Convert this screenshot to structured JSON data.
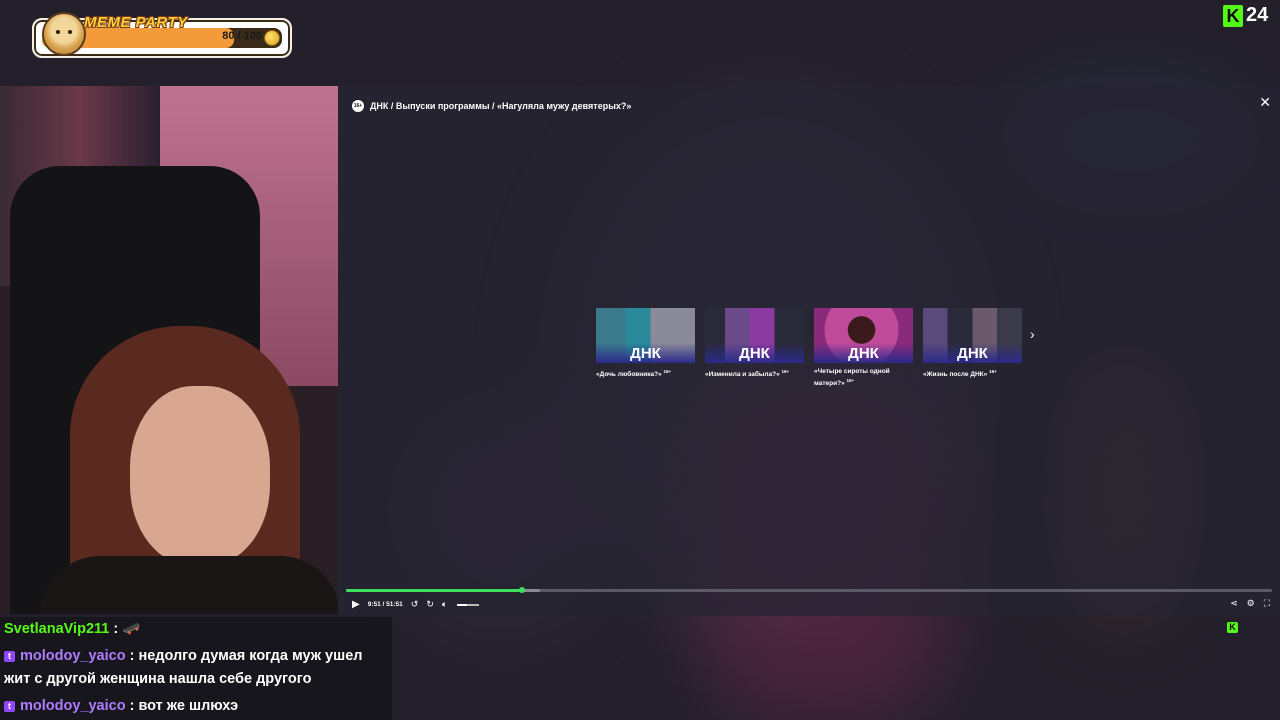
{
  "meme_widget": {
    "title": "MEME PARTY",
    "count": "80 / 100",
    "progress": 0.8
  },
  "kick_badge": {
    "letter": "K",
    "viewers": "24",
    "color": "#53fc18"
  },
  "player": {
    "age_rating": "16+",
    "breadcrumb": "ДНК / Выпуски программы / «Нагуляла мужу девятерых?»",
    "close_label": "✕",
    "cards": [
      {
        "logo": "ДНК",
        "caption": "«Дочь любовника?»",
        "rating": "16+"
      },
      {
        "logo": "ДНК",
        "caption": "«Изменила и забыла?»",
        "rating": "16+"
      },
      {
        "logo": "ДНК",
        "caption": "«Четыре сироты одной матери?»",
        "rating": "16+"
      },
      {
        "logo": "ДНК",
        "caption": "«Жизнь после ДНК»",
        "rating": "16+"
      }
    ],
    "next_label": "›",
    "time": "9:51 / 51:51",
    "progress_played": 0.19,
    "progress_buffered": 0.21,
    "volume": 0.45,
    "accent_color": "#3ce05a"
  },
  "chat": [
    {
      "platform": "kick",
      "user": "SvetlanaVip211",
      "text": " : 🛹"
    },
    {
      "platform": "twitch",
      "user": "molodoy_yaico",
      "text": " : недолго думая когда муж ушел жит с другой женщина нашла себе другого"
    },
    {
      "platform": "twitch",
      "user": "molodoy_yaico",
      "text": " : вот же шлюхэ"
    }
  ]
}
